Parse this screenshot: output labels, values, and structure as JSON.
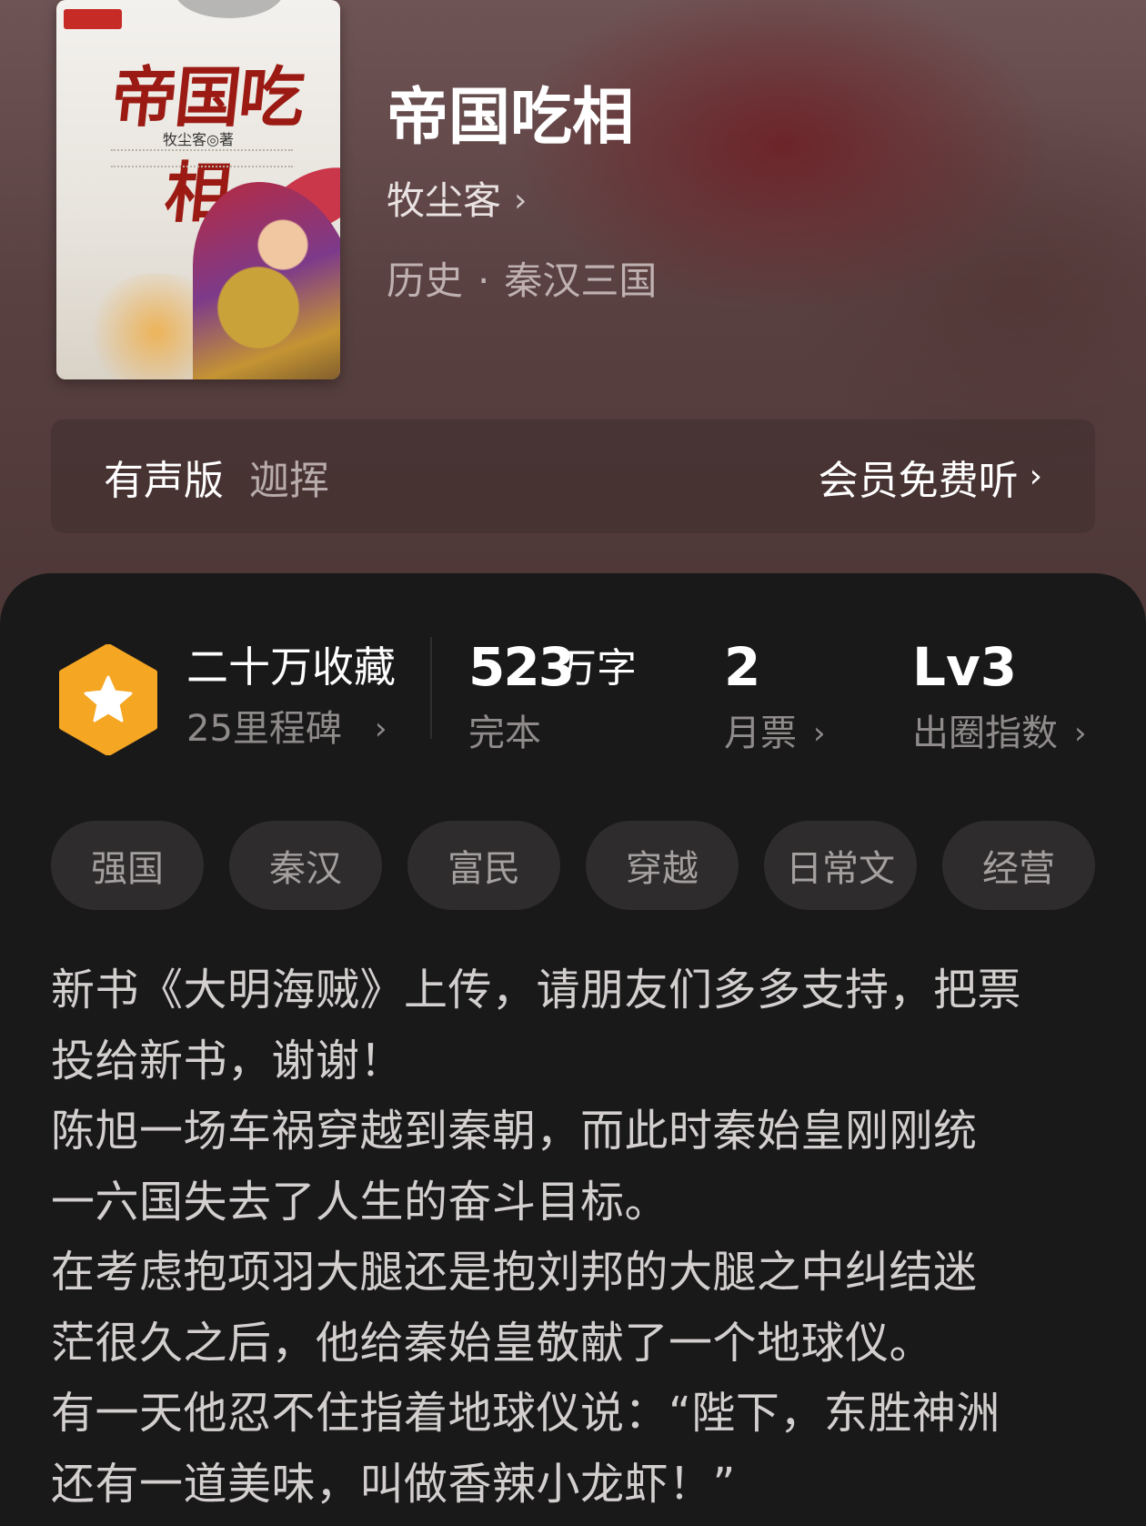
{
  "book": {
    "title": "帝国吃相",
    "author": "牧尘客",
    "author_chevron": "›",
    "category": "历史",
    "subcategory": "秦汉三国",
    "separator": "·"
  },
  "cover": {
    "title": "帝国吃相",
    "author_line": "牧尘客◎著"
  },
  "audio": {
    "label": "有声版",
    "narrator": "迦挥",
    "action": "会员免费听",
    "chevron": "›"
  },
  "stats": {
    "collections": "二十万收藏",
    "milestones": "25里程碑",
    "words_number": "523",
    "words_unit": "万字",
    "status": "完本",
    "monthly_votes": "2",
    "monthly_votes_label": "月票",
    "level": "Lv3",
    "level_label": "出圈指数",
    "chevron": "›"
  },
  "badge_color": "#f5a623",
  "tags": [
    "强国",
    "秦汉",
    "富民",
    "穿越",
    "日常文",
    "经营"
  ],
  "description": [
    "新书《大明海贼》上传，请朋友们多多支持，把票",
    "投给新书，谢谢！",
    "陈旭一场车祸穿越到秦朝，而此时秦始皇刚刚统",
    "一六国失去了人生的奋斗目标。",
    "在考虑抱项羽大腿还是抱刘邦的大腿之中纠结迷",
    "茫很久之后，他给秦始皇敬献了一个地球仪。",
    "有一天他忍不住指着地球仪说：“陛下，东胜神洲",
    "还有一道美味，叫做香辣小龙虾！”"
  ]
}
